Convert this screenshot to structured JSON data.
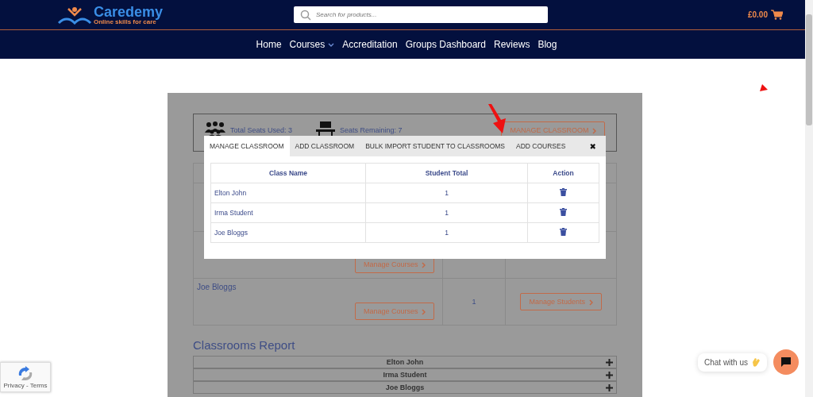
{
  "header": {
    "logo": {
      "name": "Caredemy",
      "tagline": "Online skills for care"
    },
    "search": {
      "placeholder": "Search for products..."
    },
    "cart_total": "£0.00"
  },
  "nav": [
    {
      "label": "Home",
      "dropdown": false
    },
    {
      "label": "Courses",
      "dropdown": true
    },
    {
      "label": "Accreditation",
      "dropdown": false
    },
    {
      "label": "Groups Dashboard",
      "dropdown": false
    },
    {
      "label": "Reviews",
      "dropdown": false
    },
    {
      "label": "Blog",
      "dropdown": false
    }
  ],
  "seats": {
    "used": "Total Seats Used: 3",
    "remaining": "Seats Remaining: 7",
    "button": "MANAGE CLASSROOM"
  },
  "classroom_rows": [
    {
      "kind": "covered",
      "courses_button": "Manage Courses"
    },
    {
      "kind": "full",
      "name": "Joe Bloggs",
      "courses_button": "Manage Courses",
      "total": "1",
      "students_button": "Manage Students"
    }
  ],
  "modal": {
    "tabs": [
      {
        "label": "MANAGE CLASSROOM",
        "selected": true
      },
      {
        "label": "ADD CLASSROOM",
        "selected": false
      },
      {
        "label": "BULK IMPORT STUDENT TO CLASSROOMS",
        "selected": false
      },
      {
        "label": "ADD COURSES",
        "selected": false
      }
    ],
    "close": "✖",
    "columns": [
      "Class Name",
      "Student Total",
      "Action"
    ],
    "rows": [
      {
        "name": "Elton John",
        "total": "1"
      },
      {
        "name": "Irma Student",
        "total": "1"
      },
      {
        "name": "Joe Bloggs",
        "total": "1"
      }
    ]
  },
  "report": {
    "title": "Classrooms Report",
    "items": [
      {
        "name": "Elton John",
        "expanded": false
      },
      {
        "name": "Irma Student",
        "expanded": false
      },
      {
        "name": "Joe Bloggs",
        "expanded": false
      }
    ]
  },
  "chat": {
    "label": "Chat with us"
  },
  "recaptcha": {
    "links": "Privacy - Terms"
  }
}
